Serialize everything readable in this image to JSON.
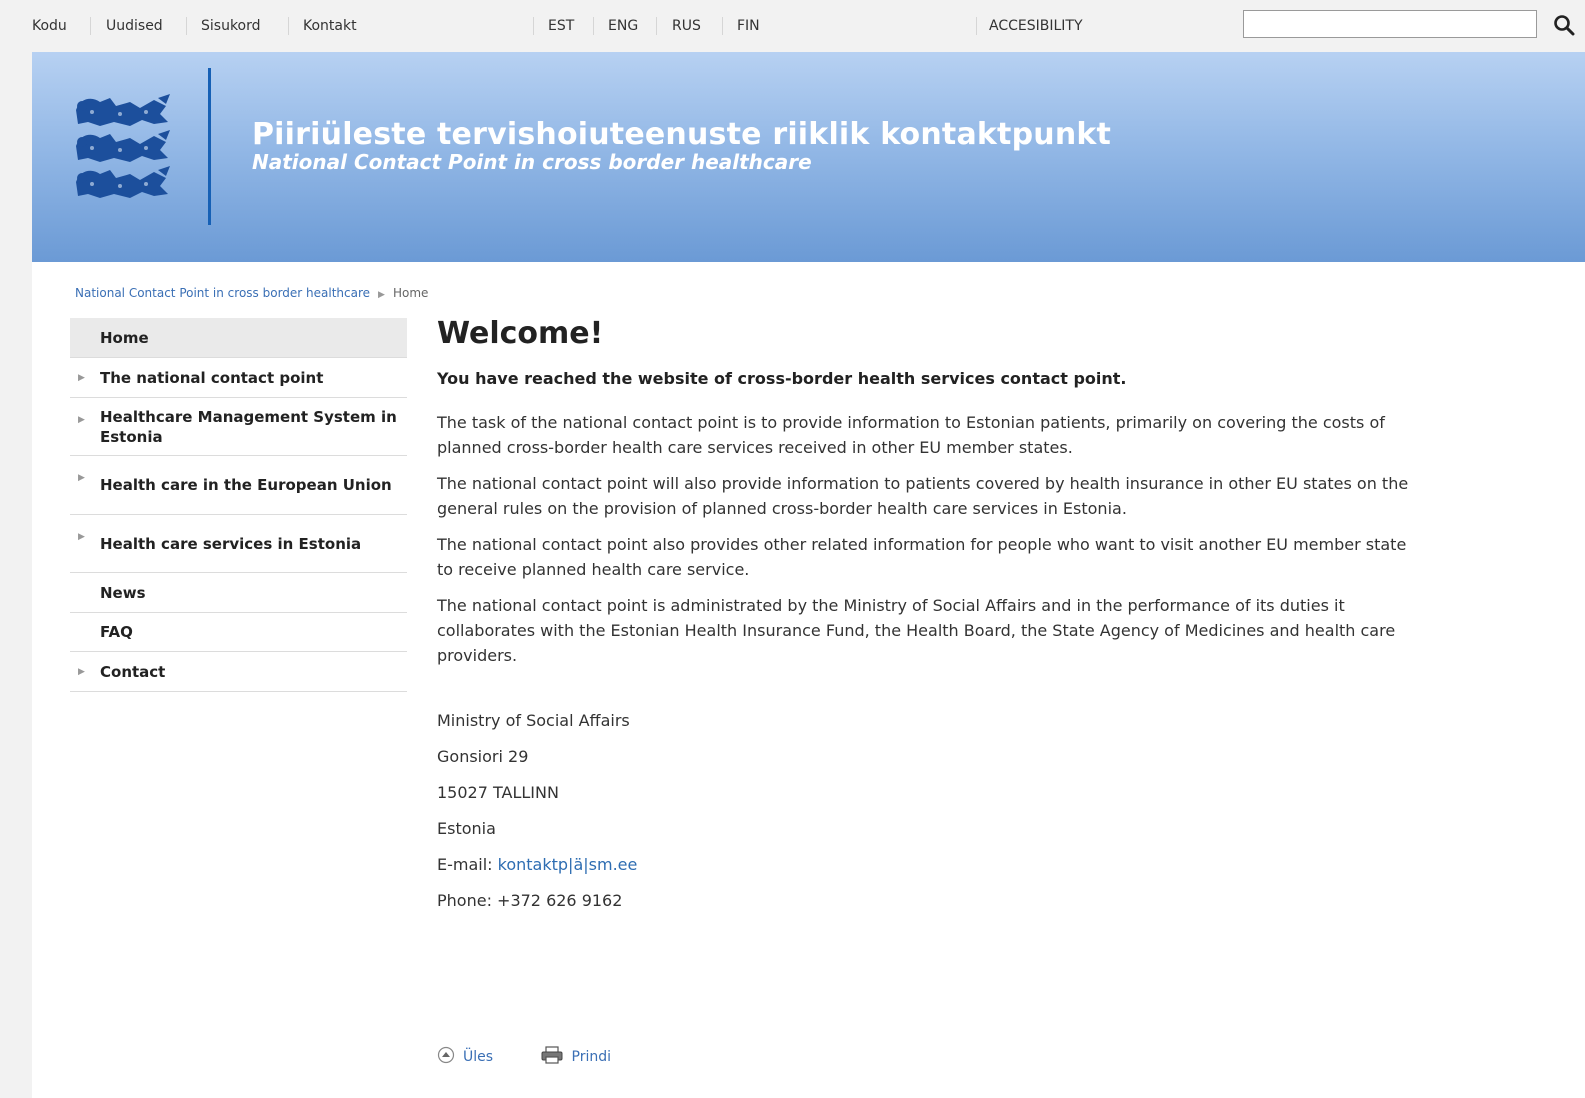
{
  "topnav": {
    "left_links": [
      "Kodu",
      "Uudised",
      "Sisukord",
      "Kontakt"
    ],
    "languages": [
      "EST",
      "ENG",
      "RUS",
      "FIN"
    ],
    "accessibility": "ACCESIBILITY",
    "search_value": ""
  },
  "header": {
    "title": "Piiriüleste tervishoiuteenuste riiklik kontaktpunkt",
    "subtitle": "National Contact Point in cross border healthcare",
    "banner_color": "#6b9ad5"
  },
  "breadcrumb": {
    "parent": "National Contact Point in cross border healthcare",
    "current": "Home"
  },
  "sidebar": {
    "items": [
      {
        "label": "Home",
        "arrow": false,
        "active": true
      },
      {
        "label": "The national contact point",
        "arrow": true
      },
      {
        "label": "Healthcare Management System in Estonia",
        "arrow": true
      },
      {
        "label": "Health care in the European Union",
        "arrow": true
      },
      {
        "label": "Health care services in Estonia",
        "arrow": true
      },
      {
        "label": "News",
        "arrow": false
      },
      {
        "label": "FAQ",
        "arrow": false
      },
      {
        "label": "Contact",
        "arrow": true
      }
    ]
  },
  "content": {
    "heading": "Welcome!",
    "lead": "You have reached the website of cross-border health services contact point.",
    "paragraphs": [
      "The task of the national contact point is to provide information to Estonian patients, primarily on covering the costs of planned cross-border health care services received in other EU member states.",
      "The national contact point will also provide information to patients covered by health insurance in other EU states on the general rules on the provision of planned cross-border health care services in Estonia.",
      "The national contact point also provides other related information for people who want to visit another EU member state to receive planned health care service.",
      "The national contact point is administrated by the Ministry of Social Affairs and in the performance of its duties it collaborates with the Estonian Health Insurance Fund, the Health Board, the State Agency of Medicines and health care providers."
    ],
    "address": {
      "org": "Ministry of Social Affairs",
      "street": "Gonsiori 29",
      "city": "15027 TALLINN",
      "country": "Estonia",
      "email_label": "E-mail:",
      "email": "kontaktp|ä|sm.ee",
      "phone": "Phone: +372 626 9162"
    }
  },
  "footer_links": {
    "up": "Üles",
    "print": "Prindi"
  }
}
